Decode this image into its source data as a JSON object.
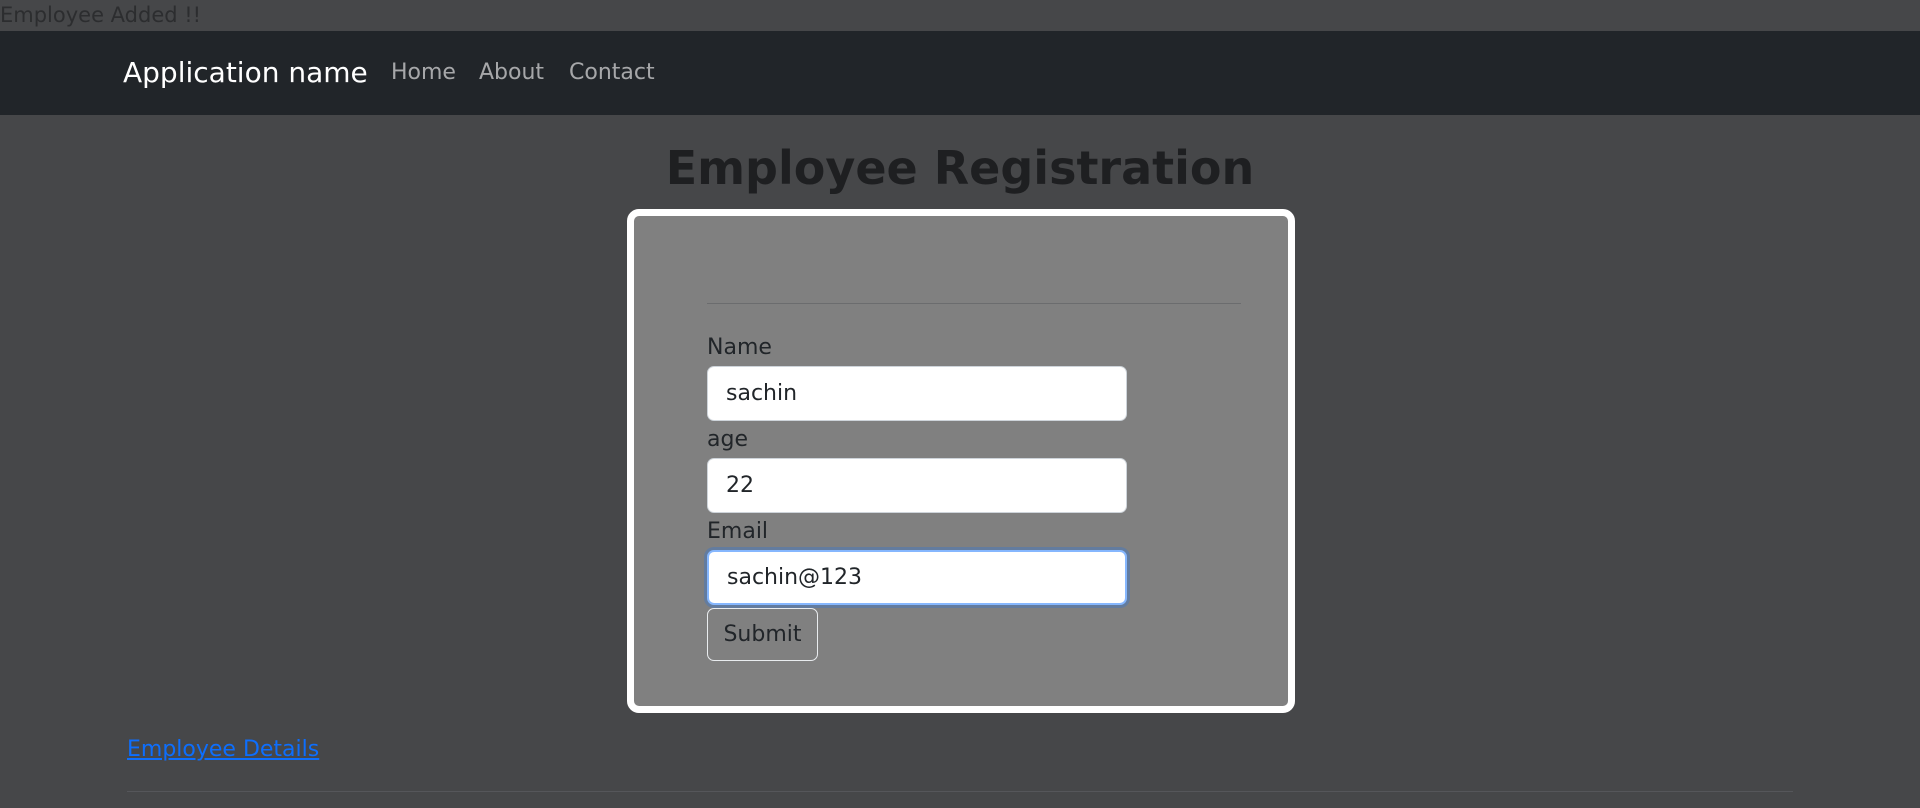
{
  "status": {
    "message": "Employee Added !!"
  },
  "navbar": {
    "brand": "Application name",
    "links": [
      "Home",
      "About",
      "Contact"
    ]
  },
  "page": {
    "title": "Employee Registration"
  },
  "form": {
    "fields": [
      {
        "label": "Name",
        "value": "sachin"
      },
      {
        "label": "age",
        "value": "22"
      },
      {
        "label": "Email",
        "value": "sachin@123",
        "focused": true
      }
    ],
    "submit_label": "Submit"
  },
  "footer": {
    "details_link": "Employee Details"
  },
  "colors": {
    "background": "#464749",
    "navbar": "#212529",
    "card": "#808080",
    "card_border": "#ffffff",
    "link": "#0d6efd",
    "focus_ring": "#86b7fe"
  }
}
